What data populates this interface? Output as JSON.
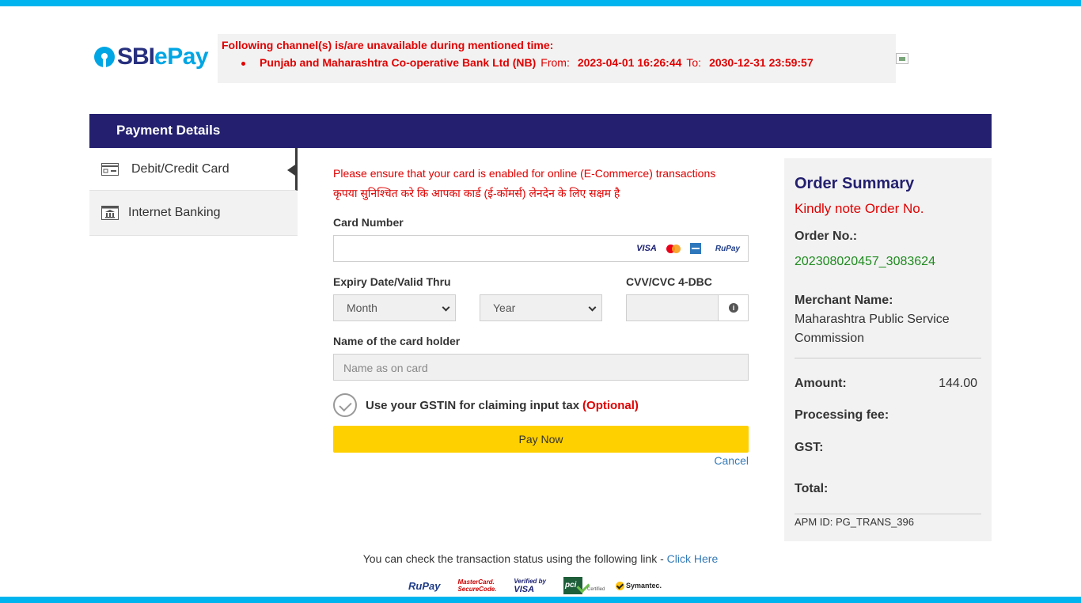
{
  "brand": {
    "logo_left": "SBI",
    "logo_right": "ePay"
  },
  "notice": {
    "title": "Following channel(s) is/are unavailable during mentioned time:",
    "items": [
      {
        "bank": "Punjab and Maharashtra Co-operative Bank Ltd (NB)",
        "from_label": "From:",
        "from": "2023-04-01 16:26:44",
        "to_label": "To:",
        "to": "2030-12-31 23:59:57"
      }
    ]
  },
  "header": {
    "title": "Payment Details"
  },
  "sidebar": {
    "items": [
      {
        "label": "Debit/Credit Card",
        "active": true,
        "icon": "card-icon"
      },
      {
        "label": "Internet Banking",
        "active": false,
        "icon": "bank-icon"
      }
    ]
  },
  "card_form": {
    "warning_en": "Please ensure that your card is enabled for online (E-Commerce) transactions",
    "warning_hi": "कृपया सुनिश्चित करे कि आपका कार्ड (ई-कॉमर्स) लेनदेन के लिए सक्षम है",
    "card_number_label": "Card Number",
    "card_number_value": "",
    "brands": {
      "visa": "VISA",
      "rupay": "RuPay"
    },
    "expiry_label": "Expiry Date/Valid Thru",
    "month_selected": "Month",
    "year_selected": "Year",
    "cvv_label": "CVV/CVC 4-DBC",
    "cvv_info": "i",
    "holder_label": "Name of the card holder",
    "holder_placeholder": "Name as on card",
    "gst_label": "Use your GSTIN for claiming input tax",
    "gst_optional": "(Optional)",
    "pay_button": "Pay Now",
    "cancel_link": "Cancel"
  },
  "summary": {
    "title": "Order Summary",
    "note": "Kindly note Order No.",
    "order_label": "Order No.:",
    "order_no": "202308020457_3083624",
    "merchant_label": "Merchant Name:",
    "merchant_line1": "Maharashtra Public Service",
    "merchant_line2": "Commission",
    "amount_label": "Amount:",
    "amount_value": "144.00",
    "fee_label": "Processing fee:",
    "gst_label": "GST:",
    "total_label": "Total:",
    "apm_id": "APM ID: PG_TRANS_396"
  },
  "footer": {
    "status_text": "You can check the transaction status using the following link - ",
    "status_link": "Click Here",
    "badges": {
      "rupay": "RuPay",
      "mastercard_1": "MasterCard.",
      "mastercard_2": "SecureCode.",
      "vbv_1": "Verified by",
      "vbv_2": "VISA",
      "pci": "pci",
      "pci_cert": "Certified",
      "symantec": "Symantec."
    }
  },
  "colors": {
    "accent": "#00b5ef",
    "header": "#24206f",
    "alert": "#e00000",
    "pay_button": "#ffd000",
    "order_green": "#1e8a1e"
  }
}
